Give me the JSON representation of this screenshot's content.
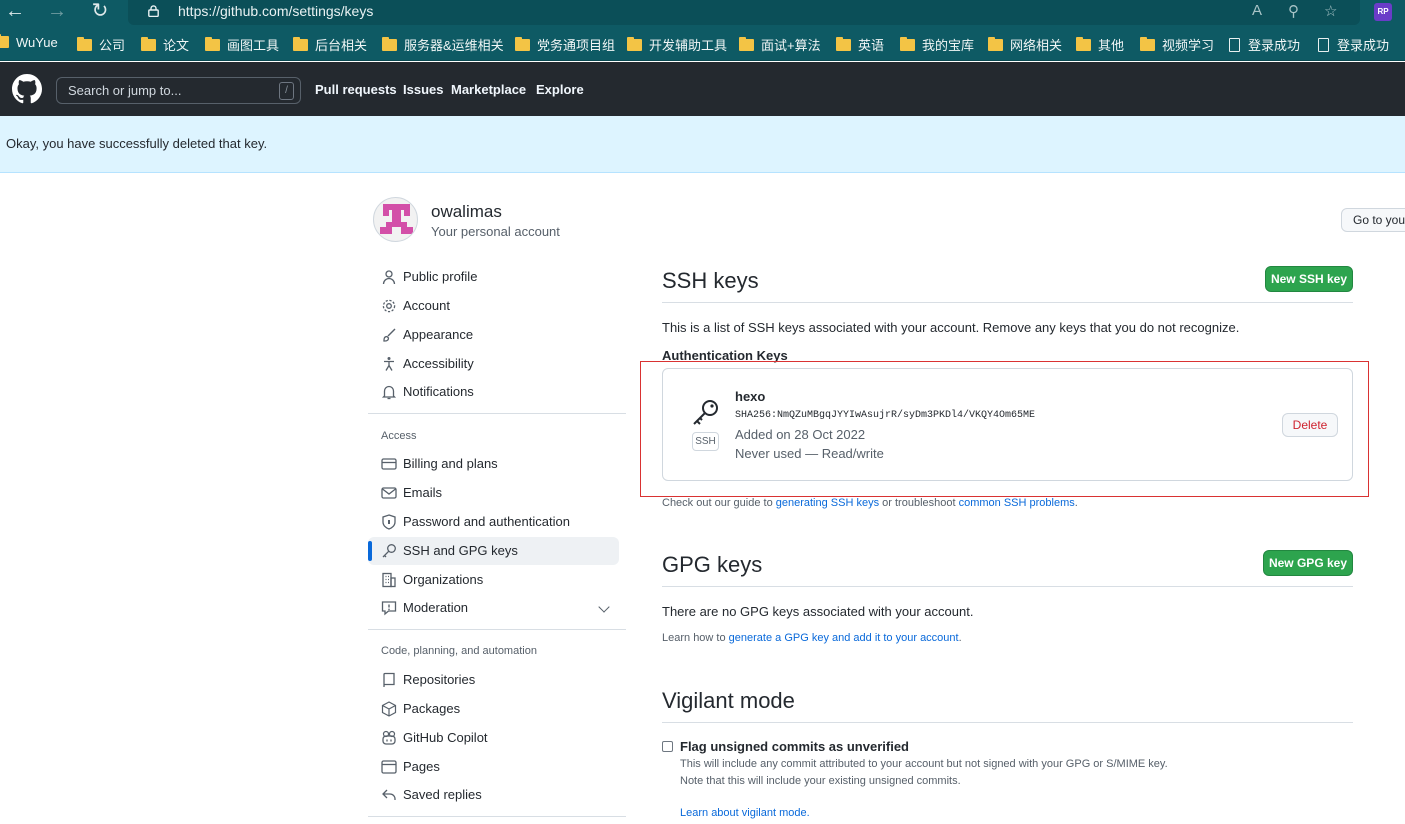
{
  "browser": {
    "url": "https://github.com/settings/keys",
    "profile_initials": "RP",
    "bookmarks": [
      {
        "label": "WuYue",
        "type": "folder"
      },
      {
        "label": "公司",
        "type": "folder"
      },
      {
        "label": "论文",
        "type": "folder"
      },
      {
        "label": "画图工具",
        "type": "folder"
      },
      {
        "label": "后台相关",
        "type": "folder"
      },
      {
        "label": "服务器&运维相关",
        "type": "folder"
      },
      {
        "label": "党务通项目组",
        "type": "folder"
      },
      {
        "label": "开发辅助工具",
        "type": "folder"
      },
      {
        "label": "面试+算法",
        "type": "folder"
      },
      {
        "label": "英语",
        "type": "folder"
      },
      {
        "label": "我的宝库",
        "type": "folder"
      },
      {
        "label": "网络相关",
        "type": "folder"
      },
      {
        "label": "其他",
        "type": "folder"
      },
      {
        "label": "视频学习",
        "type": "folder"
      },
      {
        "label": "登录成功",
        "type": "page"
      },
      {
        "label": "登录成功",
        "type": "page"
      }
    ]
  },
  "header": {
    "search_placeholder": "Search or jump to...",
    "slash_key": "/",
    "nav": [
      "Pull requests",
      "Issues",
      "Marketplace",
      "Explore"
    ]
  },
  "flash": {
    "message": "Okay, you have successfully deleted that key."
  },
  "profile": {
    "username": "owalimas",
    "subtitle": "Your personal account",
    "goto_button": "Go to your personal profile"
  },
  "sidebar": {
    "items_top": [
      "Public profile",
      "Account",
      "Appearance",
      "Accessibility",
      "Notifications"
    ],
    "access_heading": "Access",
    "items_access": [
      "Billing and plans",
      "Emails",
      "Password and authentication",
      "SSH and GPG keys",
      "Organizations",
      "Moderation"
    ],
    "code_heading": "Code, planning, and automation",
    "items_code": [
      "Repositories",
      "Packages",
      "GitHub Copilot",
      "Pages",
      "Saved replies"
    ]
  },
  "ssh": {
    "title": "SSH keys",
    "new_button": "New SSH key",
    "description": "This is a list of SSH keys associated with your account. Remove any keys that you do not recognize.",
    "auth_heading": "Authentication Keys",
    "key": {
      "name": "hexo",
      "fingerprint": "SHA256:NmQZuMBgqJYYIwAsujrR/syDm3PKDl4/VKQY4Om65ME",
      "added": "Added on 28 Oct 2022",
      "usage": "Never used — Read/write",
      "badge": "SSH",
      "delete_label": "Delete"
    },
    "guide_prefix": "Check out our guide to",
    "guide_link1": "generating SSH keys",
    "guide_mid": "or troubleshoot",
    "guide_link2": "common SSH problems",
    "guide_suffix": "."
  },
  "gpg": {
    "title": "GPG keys",
    "new_button": "New GPG key",
    "empty": "There are no GPG keys associated with your account.",
    "learn_prefix": "Learn how to",
    "learn_link": "generate a GPG key and add it to your account",
    "learn_suffix": "."
  },
  "vigilant": {
    "title": "Vigilant mode",
    "checkbox_label": "Flag unsigned commits as unverified",
    "desc1": "This will include any commit attributed to your account but not signed with your GPG or S/MIME key.",
    "desc2": "Note that this will include your existing unsigned commits.",
    "learn_link": "Learn about vigilant mode."
  },
  "colors": {
    "accent": "#0969da",
    "primary_button": "#2da44e",
    "danger": "#cf222e",
    "header_bg": "#24292f",
    "browser_bg": "#0e5a64",
    "flash_bg": "#ddf4ff",
    "highlight_box": "#d93232"
  }
}
